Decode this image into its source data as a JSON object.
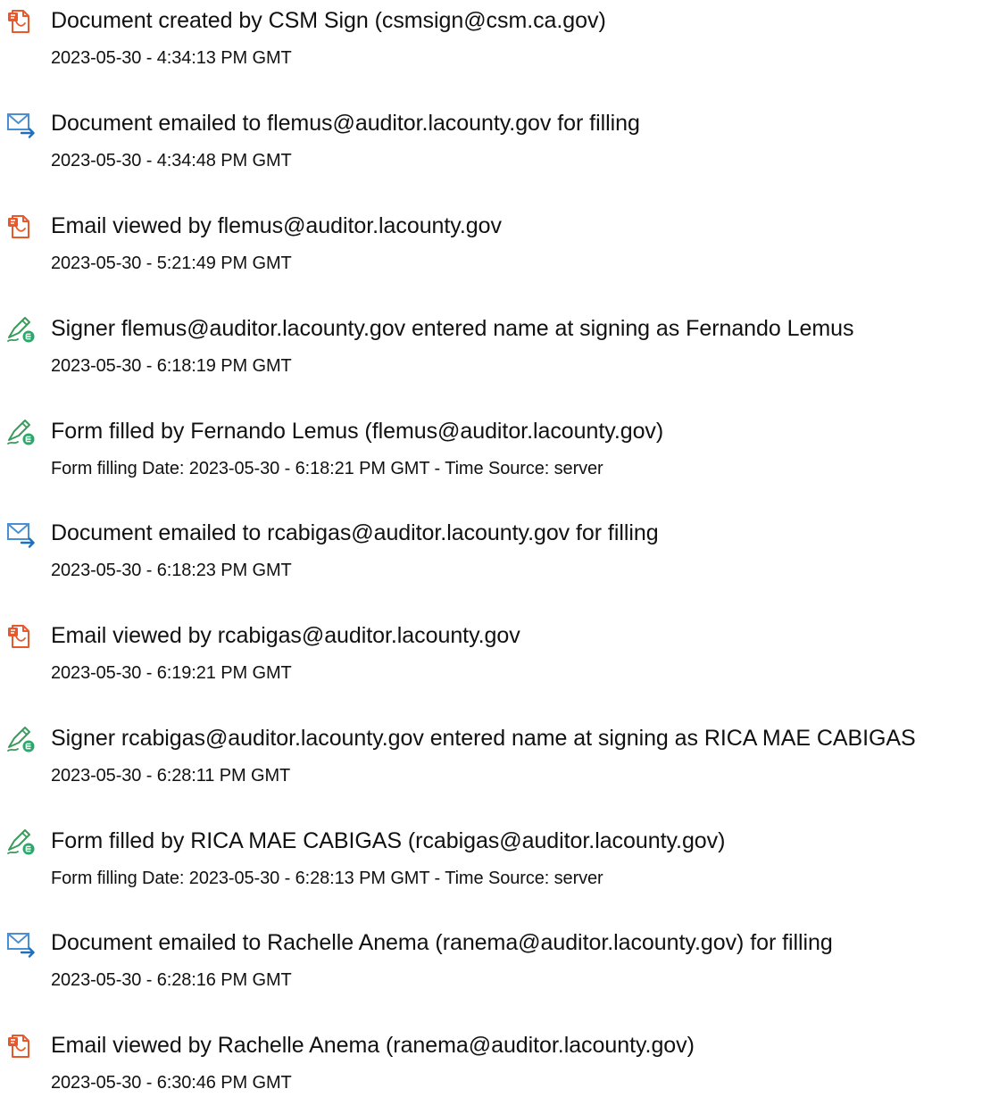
{
  "events": [
    {
      "icon": "document-icon",
      "title": "Document created by CSM Sign (csmsign@csm.ca.gov)",
      "detail": "2023-05-30 - 4:34:13 PM GMT"
    },
    {
      "icon": "email-sent-icon",
      "title": "Document emailed to flemus@auditor.lacounty.gov for filling",
      "detail": "2023-05-30 - 4:34:48 PM GMT"
    },
    {
      "icon": "document-icon",
      "title": "Email viewed by flemus@auditor.lacounty.gov",
      "detail": "2023-05-30 - 5:21:49 PM GMT"
    },
    {
      "icon": "signature-pen-icon",
      "title": "Signer flemus@auditor.lacounty.gov entered name at signing as Fernando Lemus",
      "detail": "2023-05-30 - 6:18:19 PM GMT"
    },
    {
      "icon": "signature-pen-icon",
      "title": "Form filled by Fernando Lemus (flemus@auditor.lacounty.gov)",
      "detail": "Form filling Date: 2023-05-30 - 6:18:21 PM GMT - Time Source: server"
    },
    {
      "icon": "email-sent-icon",
      "title": "Document emailed to rcabigas@auditor.lacounty.gov for filling",
      "detail": "2023-05-30 - 6:18:23 PM GMT"
    },
    {
      "icon": "document-icon",
      "title": "Email viewed by rcabigas@auditor.lacounty.gov",
      "detail": "2023-05-30 - 6:19:21 PM GMT"
    },
    {
      "icon": "signature-pen-icon",
      "title": "Signer rcabigas@auditor.lacounty.gov entered name at signing as RICA MAE CABIGAS",
      "detail": "2023-05-30 - 6:28:11 PM GMT"
    },
    {
      "icon": "signature-pen-icon",
      "title": "Form filled by RICA MAE CABIGAS (rcabigas@auditor.lacounty.gov)",
      "detail": "Form filling Date: 2023-05-30 - 6:28:13 PM GMT - Time Source: server"
    },
    {
      "icon": "email-sent-icon",
      "title": "Document emailed to Rachelle Anema (ranema@auditor.lacounty.gov) for filling",
      "detail": "2023-05-30 - 6:28:16 PM GMT"
    },
    {
      "icon": "document-icon",
      "title": "Email viewed by Rachelle Anema (ranema@auditor.lacounty.gov)",
      "detail": "2023-05-30 - 6:30:46 PM GMT"
    }
  ],
  "colors": {
    "document_icon": "#e8582a",
    "email_icon": "#4a8fd1",
    "email_arrow": "#1f6fbf",
    "signature_pen": "#3a9a5a",
    "signature_badge": "#2aa86a",
    "text": "#111111"
  }
}
